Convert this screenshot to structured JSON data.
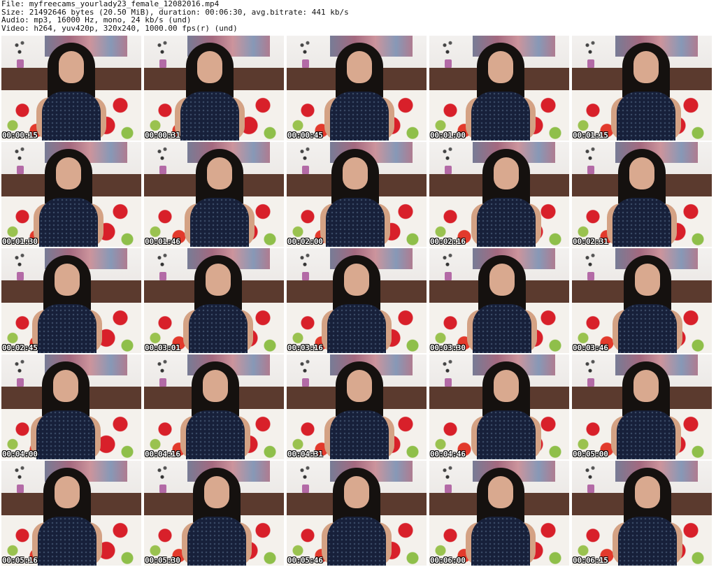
{
  "header": {
    "file_line": "File: myfreecams_yourlady23_female_12082016.mp4",
    "size_line": "Size: 21492646 bytes (20.50 MiB), duration: 00:06:30, avg.bitrate: 441 kb/s",
    "audio_line": "Audio: mp3, 16000 Hz, mono, 24 kb/s (und)",
    "video_line": "Video: h264, yuv420p, 320x240, 1000.00 fps(r) (und)"
  },
  "thumbnails": [
    "00:00:15",
    "00:00:31",
    "00:00:45",
    "00:01:00",
    "00:01:15",
    "00:01:30",
    "00:01:46",
    "00:02:00",
    "00:02:16",
    "00:02:31",
    "00:02:45",
    "00:03:01",
    "00:03:16",
    "00:03:30",
    "00:03:46",
    "00:04:00",
    "00:04:16",
    "00:04:31",
    "00:04:46",
    "00:05:00",
    "00:05:16",
    "00:05:30",
    "00:05:46",
    "00:06:00",
    "00:06:15"
  ]
}
